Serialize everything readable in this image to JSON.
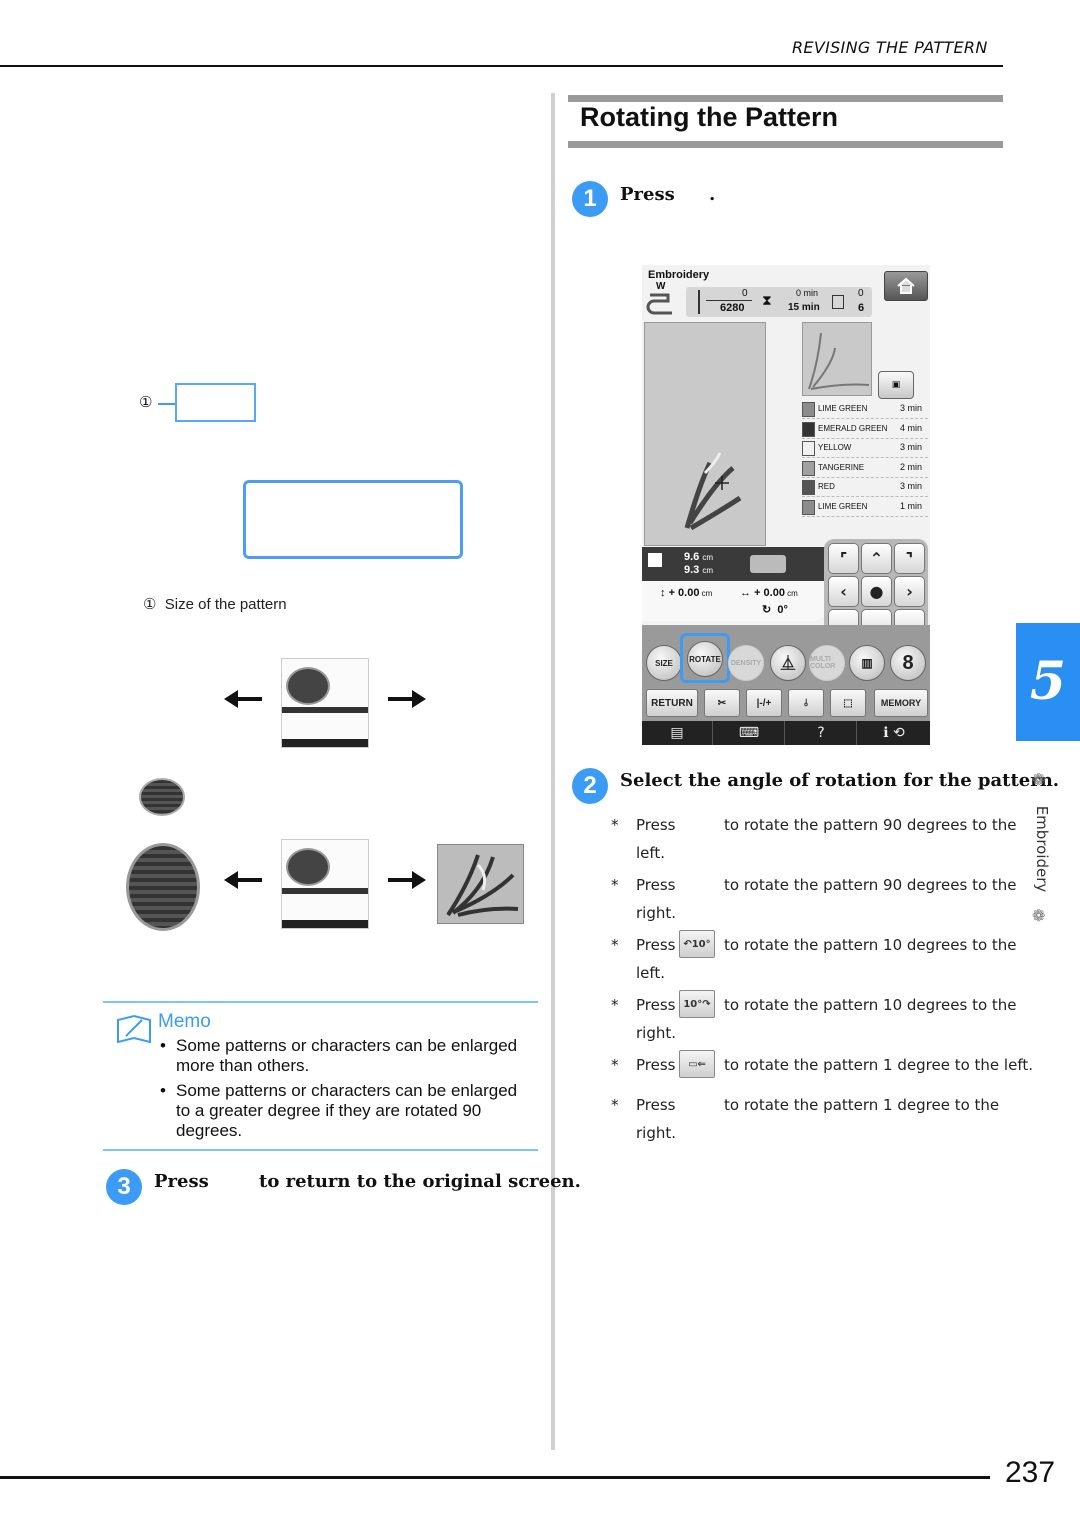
{
  "header": {
    "running_title": "REVISING THE PATTERN"
  },
  "section": {
    "title": "Rotating the Pattern"
  },
  "steps": [
    {
      "number": "1",
      "text_before": "Press",
      "text_after": "."
    },
    {
      "number": "2",
      "text": "Select the angle of rotation for the pattern."
    },
    {
      "number": "3",
      "text_before": "Press",
      "text_after": "to return to the original screen."
    }
  ],
  "rotation_bullets": [
    {
      "star": "*",
      "press": "Press",
      "icon": "",
      "icon_name": "rotate-90-left-icon",
      "desc": "to rotate the pattern 90 degrees to the",
      "cont": "left."
    },
    {
      "star": "*",
      "press": "Press",
      "icon": "",
      "icon_name": "rotate-90-right-icon",
      "desc": "to rotate the pattern 90 degrees to the",
      "cont": "right."
    },
    {
      "star": "*",
      "press": "Press",
      "icon": "↶10°",
      "icon_name": "rotate-10-left-icon",
      "desc": "to rotate the pattern 10 degrees to the",
      "cont": "left."
    },
    {
      "star": "*",
      "press": "Press",
      "icon": "10°↷",
      "icon_name": "rotate-10-right-icon",
      "desc": "to rotate the pattern 10 degrees to the",
      "cont": "right."
    },
    {
      "star": "*",
      "press": "Press",
      "icon": "▭⇐",
      "icon_name": "rotate-1-left-icon",
      "desc": "to rotate the pattern 1 degree to the left.",
      "cont": ""
    },
    {
      "star": "*",
      "press": "Press",
      "icon": "",
      "icon_name": "rotate-1-right-icon",
      "desc": "to rotate the pattern 1 degree to the",
      "cont": "right."
    }
  ],
  "machine_screen": {
    "title": "Embroidery",
    "presser_foot": "W",
    "stitch_count": "0",
    "stitch_total": "6280",
    "time_elapsed": "0 min",
    "time_total": "15 min",
    "color_count": "0",
    "color_total": "6",
    "threads": [
      {
        "name": "LIME GREEN",
        "time": "3 min",
        "color": "#8c8c8c"
      },
      {
        "name": "EMERALD GREEN",
        "time": "4 min",
        "color": "#333333"
      },
      {
        "name": "YELLOW",
        "time": "3 min",
        "color": "#f0f0f0"
      },
      {
        "name": "TANGERINE",
        "time": "2 min",
        "color": "#a0a0a0"
      },
      {
        "name": "RED",
        "time": "3 min",
        "color": "#555555"
      },
      {
        "name": "LIME GREEN",
        "time": "1 min",
        "color": "#8c8c8c"
      }
    ],
    "height": "9.6",
    "width": "9.3",
    "unit": "cm",
    "offset_v": "+ 0.00",
    "offset_h": "+ 0.00",
    "angle": "0°",
    "buttons": {
      "size": "SIZE",
      "rotate": "ROTATE",
      "density": "DENSITY",
      "multi_color": "MULTI COLOR",
      "return": "RETURN",
      "memory": "MEMORY",
      "help": "?"
    },
    "highlight_color": "#3c9cf5"
  },
  "left_column": {
    "callout_number": "①",
    "caption_number": "①",
    "caption": "Size of the pattern"
  },
  "memo": {
    "title": "Memo",
    "items": [
      "Some patterns or characters can be enlarged more than others.",
      "Some patterns or characters can be enlarged to a greater degree if they are rotated 90 degrees."
    ]
  },
  "side_tab": {
    "chapter": "5",
    "label": "Embroidery"
  },
  "footer": {
    "page_number": "237"
  }
}
